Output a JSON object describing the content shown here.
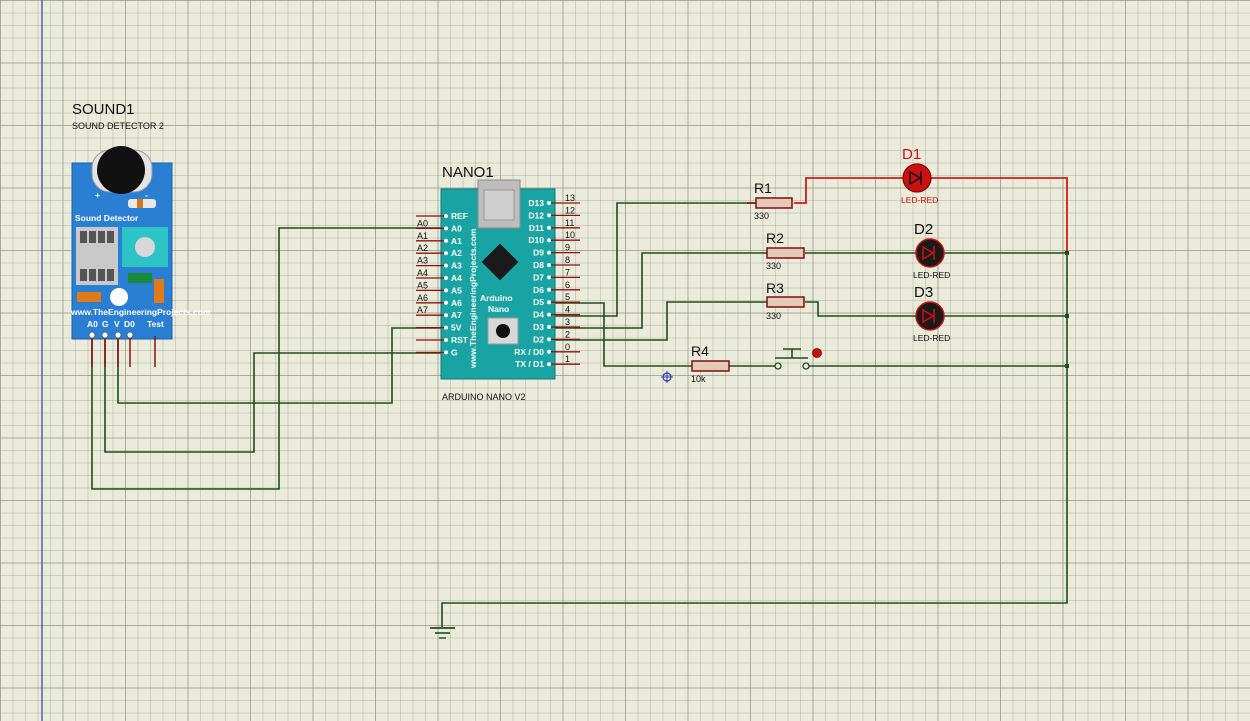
{
  "sound": {
    "ref": "SOUND1",
    "model": "SOUND DETECTOR 2",
    "board_title": "Sound Detector",
    "plus": "+",
    "minus": "-",
    "website": "www.TheEngineeringProjects.com",
    "pins": [
      "A0",
      "G",
      "V",
      "D0",
      "Test"
    ]
  },
  "nano": {
    "ref": "NANO1",
    "model": "ARDUINO NANO V2",
    "brand_line1": "Arduino",
    "brand_line2": "Nano",
    "website": "www.TheEngineeringProjects.com",
    "left_pins": [
      "REF",
      "A0",
      "A1",
      "A2",
      "A3",
      "A4",
      "A5",
      "A6",
      "A7",
      "5V",
      "RST",
      "G"
    ],
    "left_nets": [
      "A0",
      "A1",
      "A2",
      "A3",
      "A4",
      "A5",
      "A6",
      "A7"
    ],
    "right_pins": [
      "D13",
      "D12",
      "D11",
      "D10",
      "D9",
      "D8",
      "D7",
      "D6",
      "D5",
      "D4",
      "D3",
      "D2",
      "RX / D0",
      "TX / D1"
    ],
    "right_nums": [
      "13",
      "12",
      "11",
      "10",
      "9",
      "8",
      "7",
      "6",
      "5",
      "4",
      "3",
      "2",
      "0",
      "1"
    ]
  },
  "resistors": [
    {
      "ref": "R1",
      "value": "330"
    },
    {
      "ref": "R2",
      "value": "330"
    },
    {
      "ref": "R3",
      "value": "330"
    },
    {
      "ref": "R4",
      "value": "10k"
    }
  ],
  "leds": [
    {
      "ref": "D1",
      "model": "LED-RED"
    },
    {
      "ref": "D2",
      "model": "LED-RED"
    },
    {
      "ref": "D3",
      "model": "LED-RED"
    }
  ],
  "colors": {
    "board_blue": "#2b7fd3",
    "nano_teal": "#1aa3a3",
    "wire_green": "#1f4d1f",
    "wire_red": "#d11a1a",
    "led_red": "#cc1010",
    "grid": "#ebebdc"
  }
}
